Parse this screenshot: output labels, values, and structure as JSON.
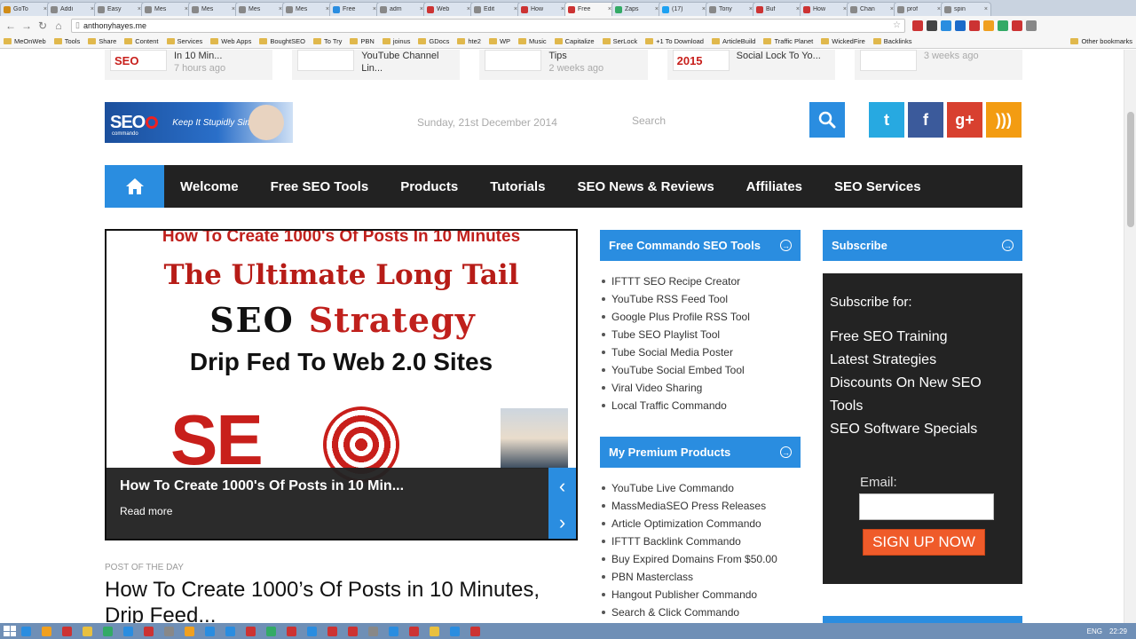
{
  "browser": {
    "tabs": [
      {
        "label": "GoTo",
        "color": "#d08c18",
        "active": false
      },
      {
        "label": "Addi",
        "color": "#888888",
        "active": false
      },
      {
        "label": "Easy",
        "color": "#888888",
        "active": false
      },
      {
        "label": "Mes",
        "color": "#888888",
        "active": false
      },
      {
        "label": "Mes",
        "color": "#888888",
        "active": false
      },
      {
        "label": "Mes",
        "color": "#888888",
        "active": false
      },
      {
        "label": "Mes",
        "color": "#888888",
        "active": false
      },
      {
        "label": "Free",
        "color": "#2a8de0",
        "active": false
      },
      {
        "label": "adm",
        "color": "#888888",
        "active": false
      },
      {
        "label": "Web",
        "color": "#cc3333",
        "active": false
      },
      {
        "label": "Edit",
        "color": "#888888",
        "active": false
      },
      {
        "label": "How",
        "color": "#cc3333",
        "active": false
      },
      {
        "label": "Free",
        "color": "#cc3333",
        "active": true
      },
      {
        "label": "Zaps",
        "color": "#33aa66",
        "active": false
      },
      {
        "label": "(17)",
        "color": "#1da1f2",
        "active": false
      },
      {
        "label": "Tony",
        "color": "#888888",
        "active": false
      },
      {
        "label": "Buf",
        "color": "#cc3333",
        "active": false
      },
      {
        "label": "How",
        "color": "#cc3333",
        "active": false
      },
      {
        "label": "Chan",
        "color": "#888888",
        "active": false
      },
      {
        "label": "prof",
        "color": "#888888",
        "active": false
      },
      {
        "label": "spin",
        "color": "#888888",
        "active": false
      }
    ],
    "url": "anthonyhayes.me",
    "bookmarks": [
      "MeOnWeb",
      "Tools",
      "Share",
      "Content",
      "Services",
      "Web Apps",
      "BoughtSEO",
      "To Try",
      "PBN",
      "joinus",
      "GDocs",
      "hte2",
      "WP",
      "Music",
      "Capitalize",
      "SerLock",
      "+1 To Download",
      "ArticleBuild",
      "Traffic Planet",
      "WickedFire",
      "Backlinks"
    ],
    "other_bookmarks": "Other bookmarks",
    "extension_colors": [
      "#cc3333",
      "#444444",
      "#2a8de0",
      "#1b6ac9",
      "#cc3333",
      "#f0a020",
      "#33aa66",
      "#cc3333",
      "#888888"
    ]
  },
  "strip": [
    {
      "thumb": "SEO",
      "text": "In 10 Min...",
      "ago": "7 hours ago"
    },
    {
      "thumb": "",
      "text": "YouTube Channel Lin...",
      "ago": ""
    },
    {
      "thumb": "",
      "text": "Tips",
      "ago": "2 weeks ago"
    },
    {
      "thumb": "2015",
      "text": "Social Lock To Yo...",
      "ago": ""
    },
    {
      "thumb": "",
      "text": "",
      "ago": "3 weeks ago"
    }
  ],
  "header": {
    "logo_text": "SEO",
    "logo_sub": "commando",
    "logo_tagline": "Keep It Stupidly Simple",
    "date": "Sunday, 21st December 2014",
    "search_placeholder": "Search",
    "social": [
      {
        "name": "twitter",
        "glyph": "t",
        "color": "#27a9e1"
      },
      {
        "name": "facebook",
        "glyph": "f",
        "color": "#3b5a9b"
      },
      {
        "name": "googleplus",
        "glyph": "g+",
        "color": "#d8402f"
      },
      {
        "name": "rss",
        "glyph": ")))",
        "color": "#f39c12"
      }
    ]
  },
  "nav": [
    "Welcome",
    "Free SEO Tools",
    "Products",
    "Tutorials",
    "SEO News & Reviews",
    "Affiliates",
    "SEO Services"
  ],
  "slider": {
    "top_line": "How To Create 1000's Of Posts In 10 Minutes",
    "headline1": "The Ultimate Long Tail",
    "headline2a": "SEO",
    "headline2b": "Strategy",
    "headline3": "Drip Fed To Web 2.0 Sites",
    "big_word": "SE",
    "caption": "How To Create 1000's Of Posts in 10 Min...",
    "read_more": "Read more",
    "prev": "‹",
    "next": "›"
  },
  "post": {
    "kicker": "POST OF THE DAY",
    "title": "How To Create 1000’s Of Posts in 10 Minutes, Drip Feed..."
  },
  "widgets": {
    "tools_title": "Free Commando SEO Tools",
    "tools": [
      "IFTTT SEO Recipe Creator",
      "YouTube RSS Feed Tool",
      "Google Plus Profile RSS Tool",
      "Tube SEO Playlist Tool",
      "Tube Social Media Poster",
      "YouTube Social Embed Tool",
      "Viral Video Sharing",
      "Local Traffic Commando"
    ],
    "products_title": "My Premium Products",
    "products": [
      "YouTube Live Commando",
      "MassMediaSEO Press Releases",
      "Article Optimization Commando",
      "IFTTT Backlink Commando",
      "Buy Expired Domains From $50.00",
      "PBN Masterclass",
      "Hangout Publisher Commando",
      "Search & Click Commando"
    ],
    "subscribe_title": "Subscribe",
    "subscribe_heading": "Subscribe for:",
    "subscribe_items": [
      "Free SEO Training",
      "Latest Strategies",
      "Discounts On New SEO Tools",
      "SEO Software Specials"
    ],
    "email_label": "Email:",
    "signup_label": "SIGN UP NOW"
  },
  "taskbar": {
    "icon_colors": [
      "#2a8de0",
      "#f0a020",
      "#cc3333",
      "#e8c040",
      "#33aa66",
      "#2a8de0",
      "#cc3333",
      "#888888",
      "#f0a020",
      "#2a8de0",
      "#2a8de0",
      "#cc3333",
      "#33aa66",
      "#cc3333",
      "#2a8de0",
      "#cc3333",
      "#cc3333",
      "#888888",
      "#2a8de0",
      "#cc3333",
      "#e8c040",
      "#2a8de0",
      "#cc3333"
    ],
    "lang": "ENG",
    "time": "22:29"
  }
}
